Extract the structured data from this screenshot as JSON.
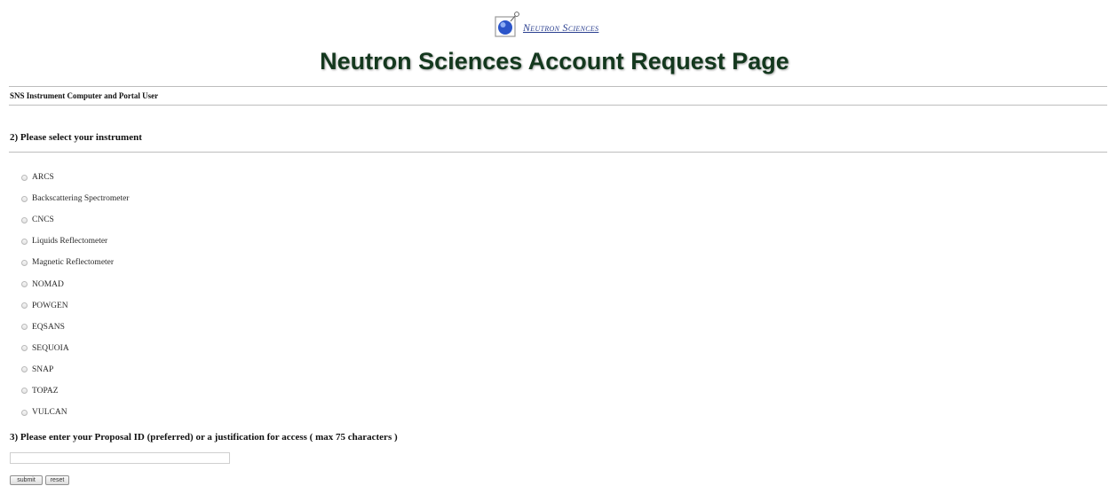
{
  "header": {
    "logo_text": "Neutron Sciences",
    "title": "Neutron Sciences Account Request Page",
    "subheader": "SNS Instrument Computer and Portal User"
  },
  "instrument_section": {
    "heading": "2) Please select your instrument",
    "options": [
      {
        "label": "ARCS",
        "selected": false
      },
      {
        "label": "Backscattering Spectrometer",
        "selected": false
      },
      {
        "label": "CNCS",
        "selected": false
      },
      {
        "label": "Liquids Reflectometer",
        "selected": false
      },
      {
        "label": "Magnetic Reflectometer",
        "selected": false
      },
      {
        "label": "NOMAD",
        "selected": false
      },
      {
        "label": "POWGEN",
        "selected": false
      },
      {
        "label": "EQSANS",
        "selected": false
      },
      {
        "label": "SEQUOIA",
        "selected": false
      },
      {
        "label": "SNAP",
        "selected": false
      },
      {
        "label": "TOPAZ",
        "selected": false
      },
      {
        "label": "VULCAN",
        "selected": false
      }
    ]
  },
  "proposal_section": {
    "heading": "3) Please enter your Proposal ID (preferred) or a justification for access ( max 75 characters )",
    "value": ""
  },
  "buttons": {
    "submit": "submit",
    "reset": "reset"
  },
  "colors": {
    "title": "#14381e",
    "logo_text": "#2a3f8f",
    "divider": "#bdbdbd"
  },
  "icons": {
    "logo": "neutron-sciences-logo-icon",
    "radio": "radio-button-unselected"
  }
}
